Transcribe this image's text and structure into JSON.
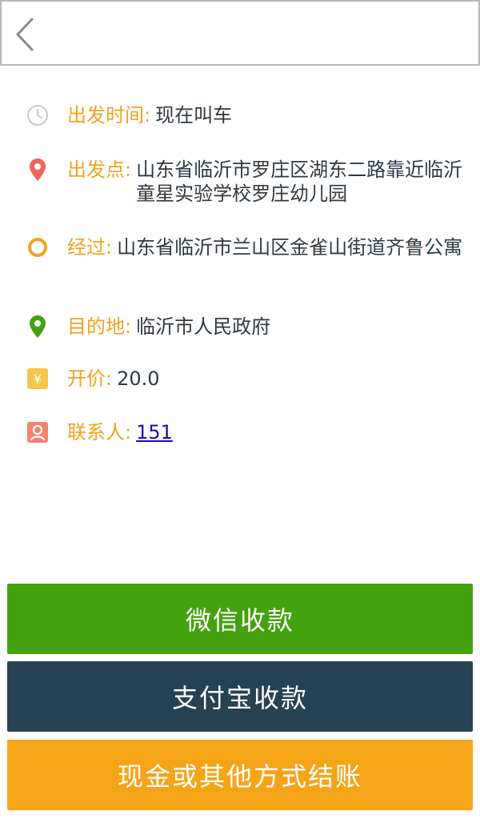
{
  "order": {
    "depart_time": {
      "label": "出发时间:",
      "value": "现在叫车"
    },
    "origin": {
      "label": "出发点:",
      "value": "山东省临沂市罗庄区湖东二路靠近临沂童星实验学校罗庄幼儿园"
    },
    "waypoint": {
      "label": "经过:",
      "value": "山东省临沂市兰山区金雀山街道齐鲁公寓"
    },
    "destination": {
      "label": "目的地:",
      "value": "临沂市人民政府"
    },
    "price": {
      "label": "开价:",
      "value": "20.0"
    },
    "contact": {
      "label": "联系人:",
      "value": "151"
    }
  },
  "buttons": {
    "wechat": "微信收款",
    "alipay": "支付宝收款",
    "cash": "现金或其他方式结账"
  },
  "icons": {
    "back": "chevron-left-icon",
    "time": "clock-icon",
    "origin": "location-pin-icon",
    "waypoint": "ring-icon",
    "destination": "location-pin-icon",
    "price": "yuan-icon",
    "contact": "person-icon"
  },
  "colors": {
    "label": "#f4a11f",
    "value": "#2b3a44",
    "pin_origin": "#f0655a",
    "waypoint": "#f4a11f",
    "pin_destination": "#44a20f",
    "wechat": "#44a20f",
    "alipay": "#274253",
    "cash": "#f6a418"
  }
}
